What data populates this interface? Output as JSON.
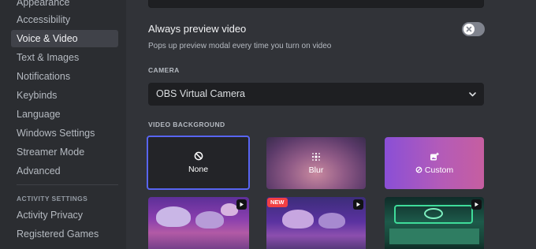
{
  "sidebar": {
    "items": [
      {
        "label": "Appearance",
        "active": false
      },
      {
        "label": "Accessibility",
        "active": false
      },
      {
        "label": "Voice & Video",
        "active": true
      },
      {
        "label": "Text & Images",
        "active": false
      },
      {
        "label": "Notifications",
        "active": false
      },
      {
        "label": "Keybinds",
        "active": false
      },
      {
        "label": "Language",
        "active": false
      },
      {
        "label": "Windows Settings",
        "active": false
      },
      {
        "label": "Streamer Mode",
        "active": false
      },
      {
        "label": "Advanced",
        "active": false
      }
    ],
    "activity_header": "ACTIVITY SETTINGS",
    "activity_items": [
      {
        "label": "Activity Privacy"
      },
      {
        "label": "Registered Games"
      }
    ]
  },
  "main": {
    "preview": {
      "title": "Always preview video",
      "description": "Pops up preview modal every time you turn on video",
      "enabled": false
    },
    "camera": {
      "label": "CAMERA",
      "selected": "OBS Virtual Camera"
    },
    "video_background": {
      "label": "VIDEO BACKGROUND",
      "options": [
        {
          "label": "None",
          "icon": "block-icon",
          "selected": true
        },
        {
          "label": "Blur",
          "icon": "blur-icon",
          "selected": false
        },
        {
          "label": "Custom",
          "icon": "image-add-icon",
          "selected": false
        }
      ],
      "thumbnails": [
        {
          "name": "mushroom-night",
          "badge": ""
        },
        {
          "name": "mushroom-night-2",
          "badge": "NEW"
        },
        {
          "name": "spaceship-cockpit",
          "badge": ""
        }
      ]
    }
  },
  "colors": {
    "accent": "#5865f2",
    "sidebar_bg": "#2b2d31",
    "content_bg": "#313338",
    "input_bg": "#1e1f22",
    "new_badge": "#f23f43"
  }
}
